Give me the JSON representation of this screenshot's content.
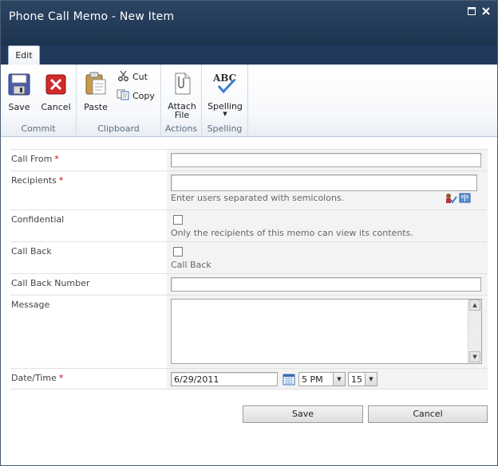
{
  "window": {
    "title": "Phone Call Memo - New Item",
    "maximize_glyph": "□",
    "close_glyph": "×"
  },
  "ribbon": {
    "tab": "Edit",
    "groups": {
      "commit": {
        "label": "Commit",
        "save": "Save",
        "cancel": "Cancel"
      },
      "clipboard": {
        "label": "Clipboard",
        "paste": "Paste",
        "cut": "Cut",
        "copy": "Copy"
      },
      "actions": {
        "label": "Actions",
        "attach_file_line1": "Attach",
        "attach_file_line2": "File"
      },
      "spelling": {
        "label": "Spelling",
        "spelling": "Spelling",
        "spelling_icon_text": "ABC"
      }
    }
  },
  "form": {
    "call_from": {
      "label": "Call From",
      "required": "*",
      "value": ""
    },
    "recipients": {
      "label": "Recipients",
      "required": "*",
      "value": "",
      "hint": "Enter users separated with semicolons."
    },
    "confidential": {
      "label": "Confidential",
      "checked": false,
      "hint": "Only the recipients of this memo can view its contents."
    },
    "call_back": {
      "label": "Call Back",
      "checked": false,
      "hint": "Call Back"
    },
    "call_back_number": {
      "label": "Call Back Number",
      "value": ""
    },
    "message": {
      "label": "Message",
      "value": ""
    },
    "date_time": {
      "label": "Date/Time",
      "required": "*",
      "date": "6/29/2011",
      "hour": "5 PM",
      "minute": "15"
    }
  },
  "footer": {
    "save": "Save",
    "cancel": "Cancel"
  },
  "colors": {
    "titlebar": "#1d3450",
    "required": "#cc0000",
    "field_bg": "#f3f3f3"
  }
}
